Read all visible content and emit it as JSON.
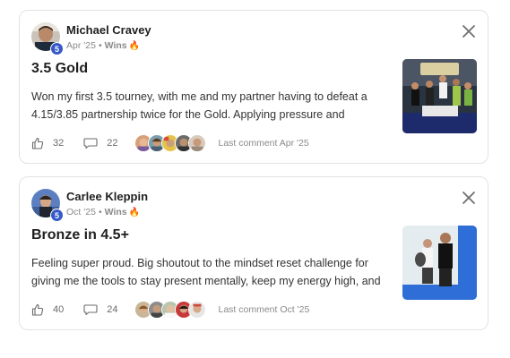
{
  "posts": [
    {
      "author": "Michael Cravey",
      "level": "5",
      "date": "Apr '25",
      "category": "Wins",
      "category_icon": "fire-icon",
      "title": "3.5 Gold",
      "body": "Won my first 3.5 tourney, with me and my partner having to defeat a 4.15/3.85 partnership twice for the Gold. Applying pressure and",
      "likes": "32",
      "comments": "22",
      "last_comment": "Last comment Apr '25"
    },
    {
      "author": "Carlee Kleppin",
      "level": "5",
      "date": "Oct '25",
      "category": "Wins",
      "category_icon": "fire-icon",
      "title": "Bronze in 4.5+",
      "body": "Feeling super proud. Big shoutout to the mindset reset challenge for giving me the tools to stay present mentally, keep my energy high, and",
      "likes": "40",
      "comments": "24",
      "last_comment": "Last comment Oct '25"
    }
  ],
  "colors": {
    "level_badge": "#3659c9",
    "border": "#e3e3e3",
    "muted": "#8a8a8a"
  }
}
